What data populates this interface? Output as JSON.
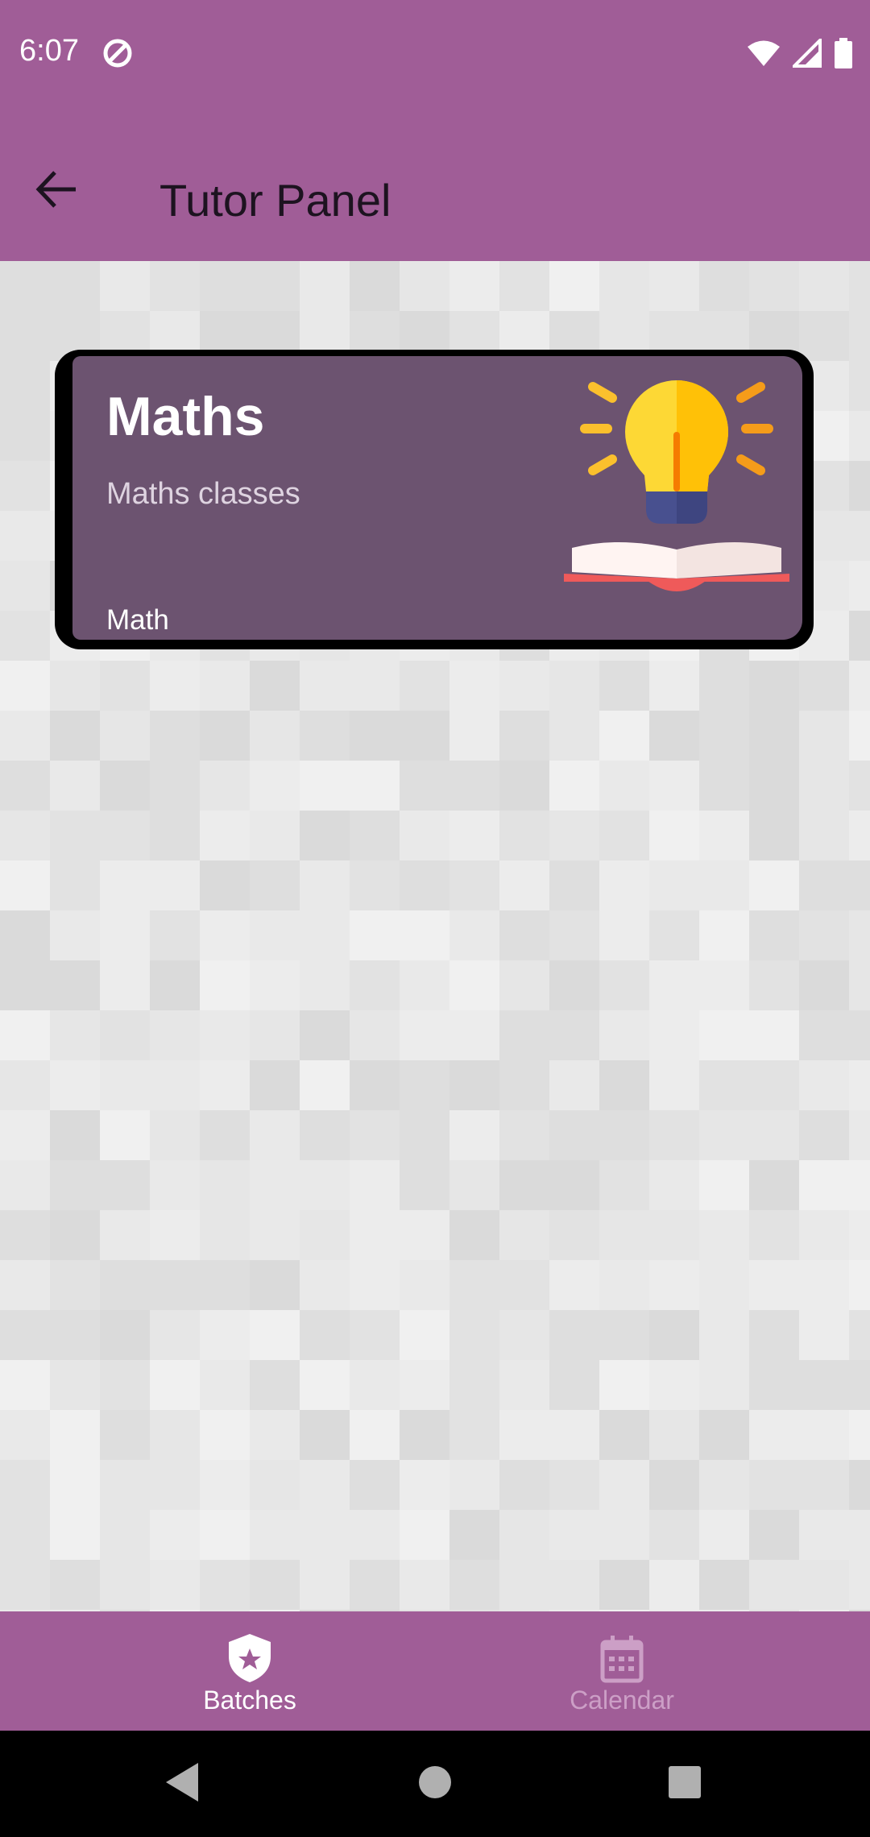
{
  "status_bar": {
    "time": "6:07"
  },
  "app_bar": {
    "title": "Tutor Panel"
  },
  "batches": [
    {
      "title": "Maths",
      "subtitle": "Maths classes",
      "tag": "Math"
    }
  ],
  "fab": {
    "label": "+"
  },
  "bottom_nav": {
    "items": [
      {
        "label": "Batches",
        "icon": "shield-star-icon",
        "active": true
      },
      {
        "label": "Calendar",
        "icon": "calendar-icon",
        "active": false
      }
    ]
  },
  "colors": {
    "primary": "#a05d97",
    "card": "#6c5370",
    "fab": "#bd433a",
    "nav_active": "#ffffff",
    "nav_inactive": "#cc9fc6"
  }
}
